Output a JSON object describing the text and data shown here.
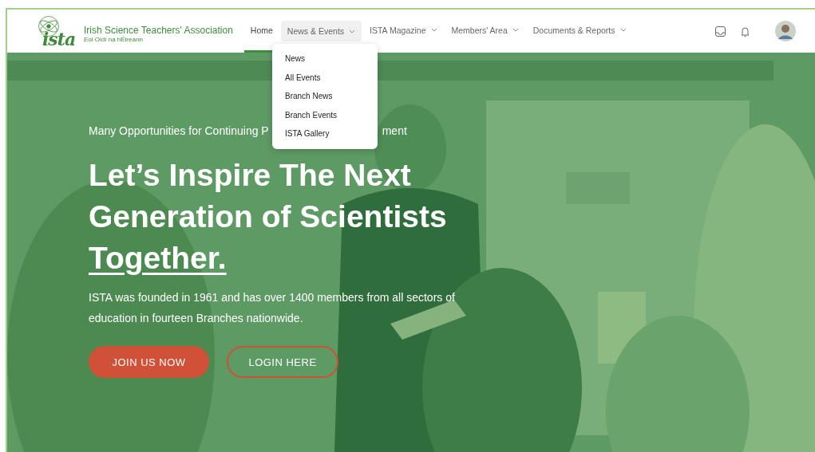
{
  "logo": {
    "wordmark": "ista",
    "title": "Irish Science Teachers' Association",
    "subtitle": "Eol Oidí na hÉireann"
  },
  "nav": [
    {
      "label": "Home",
      "selected": true,
      "expanded": false,
      "caret": false
    },
    {
      "label": "News & Events",
      "selected": false,
      "expanded": true,
      "caret": true
    },
    {
      "label": "ISTA Magazine",
      "selected": false,
      "expanded": false,
      "caret": true
    },
    {
      "label": "Members' Area",
      "selected": false,
      "expanded": false,
      "caret": true
    },
    {
      "label": "Documents & Reports",
      "selected": false,
      "expanded": false,
      "caret": true
    }
  ],
  "dropdown": {
    "items": [
      "News",
      "All Events",
      "Branch News",
      "Branch Events",
      "ISTA Gallery"
    ]
  },
  "hero": {
    "kicker_parts": [
      "Many Opportunities for Continuing P",
      "ment"
    ],
    "title": "Let’s Inspire The Next Generation of Scientists",
    "title_emphasis": "Together.",
    "text": "ISTA was founded in 1961 and has over 1400 members from all sectors of education in fourteen Branches nationwide.",
    "buttons": [
      {
        "label": "JOIN US NOW",
        "kind": "filled"
      },
      {
        "label": "LOGIN HERE",
        "kind": "outline"
      }
    ]
  }
}
